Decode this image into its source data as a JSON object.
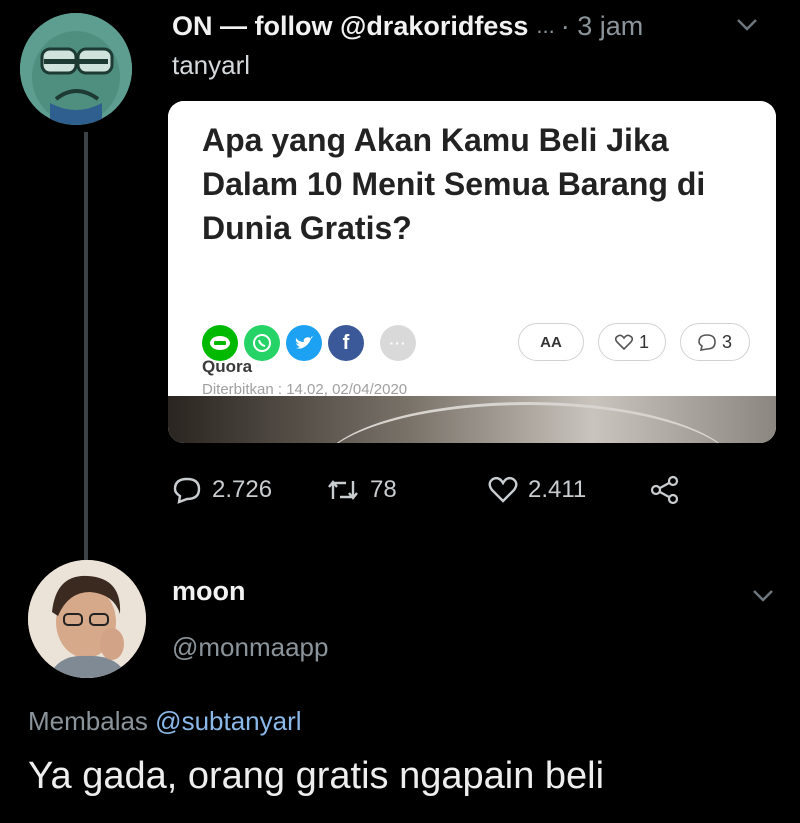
{
  "tweet": {
    "display_name": "ON — follow @drakoridfess",
    "ellipsis": "...",
    "time": "· 3 jam",
    "handle": "tanyarl",
    "card": {
      "title": "Apa yang Akan Kamu Beli Jika Dalam 10 Menit Semua Barang di Dunia Gratis?",
      "source": "Quora",
      "published": "Diterbitkan : 14.02, 02/04/2020",
      "font_size_button": "AA",
      "like_count": "1",
      "comment_count": "3"
    },
    "stats": {
      "replies": "2.726",
      "retweets": "78",
      "likes": "2.411"
    }
  },
  "reply": {
    "display_name": "moon",
    "handle": "@monmaapp",
    "replying_label": "Membalas",
    "replying_to": "@subtanyarl",
    "text": "Ya gada, orang gratis ngapain beli"
  },
  "colors": {
    "background": "#000000",
    "mention": "#8ab8e8",
    "muted": "#8b949a",
    "line_green": "#00b900",
    "whatsapp_green": "#25d366",
    "twitter_blue": "#1da1f2",
    "facebook_blue": "#3b5998"
  },
  "icons": [
    "chevron-down-icon",
    "reply-icon",
    "retweet-icon",
    "heart-icon",
    "share-icon",
    "line-icon",
    "whatsapp-icon",
    "twitter-icon",
    "facebook-icon",
    "more-icon"
  ]
}
